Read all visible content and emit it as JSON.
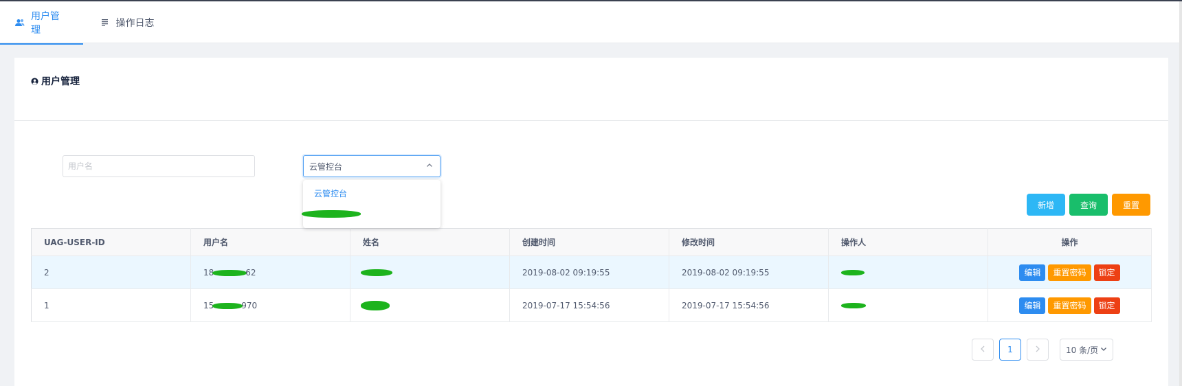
{
  "tabs": [
    {
      "label": "用户管理",
      "icon": "users-icon",
      "active": true
    },
    {
      "label": "操作日志",
      "icon": "list-icon",
      "active": false
    }
  ],
  "card": {
    "title": "用户管理",
    "icon": "user-circle-icon"
  },
  "filters": {
    "username_placeholder": "用户名",
    "system_select": {
      "value": "云管控台",
      "options": [
        "云管控台",
        ""
      ]
    }
  },
  "buttons": {
    "add": "新增",
    "query": "查询",
    "reset": "重置"
  },
  "table": {
    "columns": [
      "UAG-USER-ID",
      "用户名",
      "姓名",
      "创建时间",
      "修改时间",
      "操作人",
      "操作"
    ],
    "rows": [
      {
        "id": "2",
        "username_prefix": "18",
        "username_suffix": "62",
        "created": "2019-08-02 09:19:55",
        "modified": "2019-08-02 09:19:55"
      },
      {
        "id": "1",
        "username_prefix": "15",
        "username_suffix": "970",
        "created": "2019-07-17 15:54:56",
        "modified": "2019-07-17 15:54:56"
      }
    ],
    "actions": {
      "edit": "编辑",
      "reset_password": "重置密码",
      "lock": "锁定"
    }
  },
  "pagination": {
    "current": "1",
    "page_size": "10 条/页",
    "prev_icon": "chevron-left-icon",
    "next_icon": "chevron-right-icon"
  },
  "colors": {
    "primary": "#2d8cf0",
    "info": "#2db7f5",
    "success": "#19be6b",
    "warning": "#ff9900",
    "error": "#ed4014",
    "redaction": "#1db31d"
  }
}
